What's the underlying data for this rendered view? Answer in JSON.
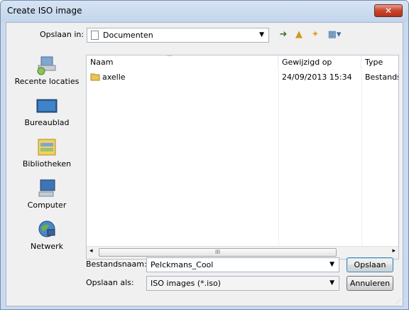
{
  "window": {
    "title": "Create ISO image",
    "close_label": "✕"
  },
  "toolbar": {
    "save_in_label": "Opslaan in:",
    "location_value": "Documenten",
    "icons": [
      "back-icon",
      "up-folder-icon",
      "new-folder-icon",
      "view-menu-icon"
    ]
  },
  "places": [
    {
      "label": "Recente locaties",
      "icon": "recent-places-icon"
    },
    {
      "label": "Bureaublad",
      "icon": "desktop-icon"
    },
    {
      "label": "Bibliotheken",
      "icon": "libraries-icon"
    },
    {
      "label": "Computer",
      "icon": "computer-icon"
    },
    {
      "label": "Netwerk",
      "icon": "network-icon"
    }
  ],
  "filelist": {
    "columns": [
      "Naam",
      "Gewijzigd op",
      "Type"
    ],
    "rows": [
      {
        "name": "axelle",
        "modified": "24/09/2013 15:34",
        "type": "Bestandsr"
      }
    ],
    "scroll_grip": "III"
  },
  "form": {
    "filename_label": "Bestandsnaam:",
    "filename_value": "Pelckmans_Cool",
    "filetype_label": "Opslaan als:",
    "filetype_value": "ISO images (*.iso)"
  },
  "buttons": {
    "save": "Opslaan",
    "cancel": "Annuleren"
  }
}
